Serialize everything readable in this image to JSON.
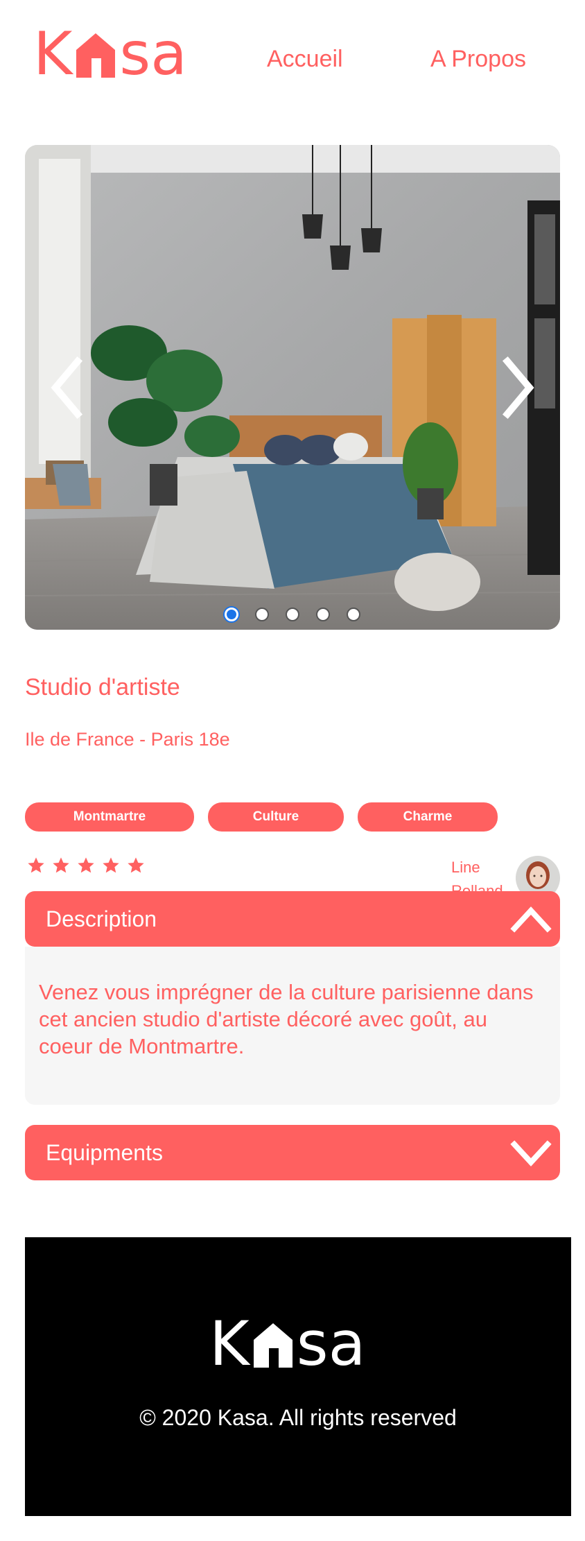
{
  "brand": {
    "logo_letters": [
      "K",
      "s",
      "a"
    ],
    "logo_color": "#FF6060"
  },
  "nav": {
    "items": [
      {
        "label": "Accueil"
      },
      {
        "label": "A Propos"
      }
    ]
  },
  "carousel": {
    "total_slides": 5,
    "active_index": 0,
    "prev_icon": "chevron-left-icon",
    "next_icon": "chevron-right-icon",
    "dot_active_color": "#1a73e8"
  },
  "listing": {
    "title": "Studio d'artiste",
    "location": "Ile de France - Paris 18e",
    "tags": [
      "Montmartre",
      "Culture",
      "Charme"
    ],
    "rating": 5,
    "rating_max": 5,
    "host": {
      "first_name": "Line",
      "last_name": "Rolland"
    }
  },
  "collapses": {
    "description": {
      "title": "Description",
      "expanded": true,
      "text": "Venez vous imprégner de la culture parisienne dans cet ancien studio d'artiste décoré avec goût, au coeur de Montmartre."
    },
    "equipments": {
      "title": "Equipments",
      "expanded": false
    }
  },
  "footer": {
    "copyright": "© 2020 Kasa. All rights reserved"
  },
  "colors": {
    "accent": "#FF6060",
    "panel": "#F6F6F6",
    "footer_bg": "#000000"
  }
}
